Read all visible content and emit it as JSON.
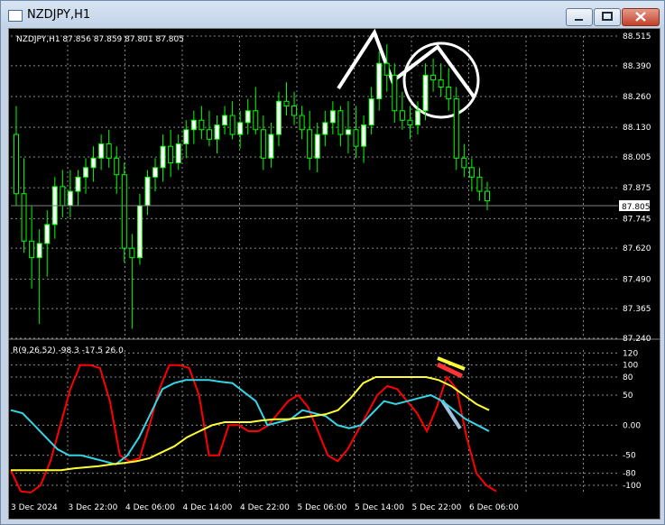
{
  "window": {
    "title": "NZDJPY,H1",
    "buttons": {
      "minimize": "minimize-icon",
      "maximize": "maximize-icon",
      "close": "close-icon"
    }
  },
  "price_panel": {
    "header": "NZDJPY,H1  87.856 87.859 87.801 87.805",
    "current_price_label": "87.805"
  },
  "indicator_panel": {
    "header": "R(9,26,52) -98.3 -17.5 26.0"
  },
  "colors": {
    "background": "#000000",
    "grid": "#8a8a8a",
    "bull_candle": "#ffffff",
    "bear_candle": "#000000",
    "wick": "#00ff00",
    "fast_line": "#ff0000",
    "mid_line": "#33d6e6",
    "slow_line": "#ffff33"
  },
  "chart_data": [
    {
      "type": "candlestick",
      "title": "NZDJPY,H1",
      "ylim": [
        87.24,
        88.515
      ],
      "y_ticks": [
        "88.515",
        "88.390",
        "88.260",
        "88.130",
        "88.005",
        "87.875",
        "87.745",
        "87.620",
        "87.490",
        "87.365",
        "87.240"
      ],
      "x_ticks": [
        "3 Dec 2024",
        "3 Dec 22:00",
        "4 Dec 06:00",
        "4 Dec 14:00",
        "4 Dec 22:00",
        "5 Dec 06:00",
        "5 Dec 14:00",
        "5 Dec 22:00",
        "6 Dec 06:00"
      ],
      "ohlc": [
        [
          88.1,
          88.22,
          87.8,
          87.85
        ],
        [
          87.85,
          88.0,
          87.6,
          87.65
        ],
        [
          87.65,
          87.8,
          87.45,
          87.58
        ],
        [
          87.58,
          87.7,
          87.3,
          87.64
        ],
        [
          87.64,
          87.78,
          87.5,
          87.72
        ],
        [
          87.72,
          87.92,
          87.66,
          87.88
        ],
        [
          87.88,
          87.95,
          87.75,
          87.8
        ],
        [
          87.8,
          87.95,
          87.75,
          87.86
        ],
        [
          87.86,
          87.95,
          87.8,
          87.92
        ],
        [
          87.92,
          88.0,
          87.85,
          87.96
        ],
        [
          87.96,
          88.05,
          87.9,
          88.0
        ],
        [
          88.0,
          88.1,
          87.95,
          88.06
        ],
        [
          88.06,
          88.12,
          87.96,
          88.0
        ],
        [
          88.0,
          88.05,
          87.85,
          87.93
        ],
        [
          87.93,
          87.98,
          87.56,
          87.62
        ],
        [
          87.62,
          87.68,
          87.28,
          87.58
        ],
        [
          87.58,
          87.85,
          87.55,
          87.8
        ],
        [
          87.8,
          87.95,
          87.76,
          87.92
        ],
        [
          87.92,
          88.0,
          87.86,
          87.96
        ],
        [
          87.96,
          88.1,
          87.9,
          88.05
        ],
        [
          88.05,
          88.12,
          87.92,
          87.98
        ],
        [
          87.98,
          88.1,
          87.95,
          88.06
        ],
        [
          88.06,
          88.16,
          88.0,
          88.12
        ],
        [
          88.12,
          88.2,
          88.06,
          88.16
        ],
        [
          88.16,
          88.22,
          88.08,
          88.12
        ],
        [
          88.12,
          88.2,
          88.05,
          88.08
        ],
        [
          88.08,
          88.18,
          88.02,
          88.14
        ],
        [
          88.14,
          88.22,
          88.1,
          88.18
        ],
        [
          88.18,
          88.24,
          88.08,
          88.1
        ],
        [
          88.1,
          88.2,
          88.04,
          88.15
        ],
        [
          88.15,
          88.25,
          88.1,
          88.2
        ],
        [
          88.2,
          88.3,
          88.1,
          88.12
        ],
        [
          88.12,
          88.18,
          87.95,
          88.0
        ],
        [
          88.0,
          88.15,
          87.96,
          88.1
        ],
        [
          88.1,
          88.28,
          88.05,
          88.24
        ],
        [
          88.24,
          88.32,
          88.18,
          88.22
        ],
        [
          88.22,
          88.28,
          88.14,
          88.18
        ],
        [
          88.18,
          88.22,
          88.08,
          88.12
        ],
        [
          88.12,
          88.2,
          87.95,
          88.0
        ],
        [
          88.0,
          88.15,
          87.94,
          88.1
        ],
        [
          88.1,
          88.2,
          88.05,
          88.15
        ],
        [
          88.15,
          88.24,
          88.1,
          88.2
        ],
        [
          88.2,
          88.22,
          88.05,
          88.1
        ],
        [
          88.1,
          88.24,
          88.02,
          88.12
        ],
        [
          88.12,
          88.22,
          88.0,
          88.05
        ],
        [
          88.05,
          88.18,
          87.98,
          88.14
        ],
        [
          88.14,
          88.3,
          88.1,
          88.25
        ],
        [
          88.25,
          88.45,
          88.2,
          88.4
        ],
        [
          88.4,
          88.48,
          88.28,
          88.35
        ],
        [
          88.35,
          88.4,
          88.15,
          88.2
        ],
        [
          88.2,
          88.28,
          88.12,
          88.16
        ],
        [
          88.16,
          88.22,
          88.08,
          88.14
        ],
        [
          88.14,
          88.24,
          88.1,
          88.2
        ],
        [
          88.2,
          88.4,
          88.16,
          88.35
        ],
        [
          88.35,
          88.42,
          88.28,
          88.33
        ],
        [
          88.33,
          88.4,
          88.26,
          88.3
        ],
        [
          88.3,
          88.38,
          88.2,
          88.25
        ],
        [
          88.25,
          88.3,
          87.95,
          88.0
        ],
        [
          88.0,
          88.06,
          87.92,
          87.96
        ],
        [
          87.96,
          88.0,
          87.86,
          87.92
        ],
        [
          87.92,
          87.96,
          87.82,
          87.86
        ],
        [
          87.86,
          87.9,
          87.78,
          87.82
        ]
      ]
    },
    {
      "type": "line",
      "title": "R(9,26,52) -98.3 -17.5 26.0",
      "ylim": [
        -115,
        125
      ],
      "y_ticks": [
        120,
        100,
        80,
        50,
        0.0,
        -50,
        -80,
        -100
      ],
      "series": [
        {
          "values": [
            -75,
            -110,
            -112,
            -100,
            -60,
            0,
            60,
            100,
            100,
            95,
            40,
            -50,
            -60,
            -55,
            0,
            60,
            100,
            100,
            95,
            50,
            -50,
            -50,
            0,
            0,
            -10,
            -10,
            0,
            20,
            40,
            50,
            30,
            -10,
            -50,
            -60,
            -40,
            -10,
            20,
            50,
            65,
            60,
            40,
            20,
            -10,
            30,
            80,
            60,
            -20,
            -80,
            -100,
            -110
          ]
        },
        {
          "values": [
            25,
            20,
            0,
            -20,
            -40,
            -50,
            -50,
            -55,
            -60,
            -65,
            -50,
            -20,
            20,
            60,
            70,
            75,
            75,
            75,
            72,
            70,
            55,
            40,
            0,
            5,
            10,
            25,
            20,
            15,
            0,
            -5,
            0,
            20,
            40,
            35,
            40,
            45,
            50,
            40,
            25,
            10,
            0,
            -10
          ]
        },
        {
          "values": [
            -75,
            -75,
            -75,
            -75,
            -75,
            -72,
            -70,
            -68,
            -65,
            -63,
            -60,
            -55,
            -45,
            -35,
            -20,
            -10,
            0,
            5,
            5,
            5,
            8,
            10,
            10,
            12,
            15,
            18,
            25,
            45,
            70,
            80,
            80,
            80,
            80,
            80,
            75,
            65,
            50,
            35,
            25
          ]
        }
      ]
    }
  ]
}
